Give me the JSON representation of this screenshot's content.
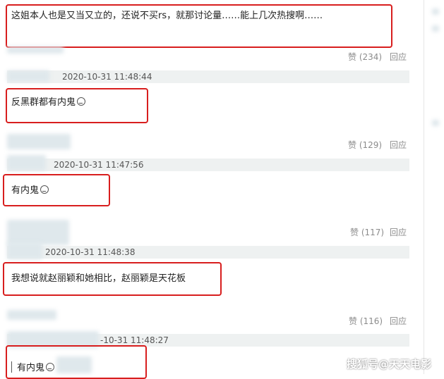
{
  "comments": [
    {
      "text": "这姐本人也是又当又立的，还说不买rs，就那讨论量……能上几次热搜啊……",
      "like": "赞 (234)",
      "reply": "回应",
      "timestamp": "2020-10-31 11:48:44"
    },
    {
      "text": "反黑群都有内鬼",
      "like": "赞 (129)",
      "reply": "回应",
      "timestamp": "2020-10-31 11:47:56"
    },
    {
      "text": "有内鬼",
      "like": "赞 (117)",
      "reply": "回应",
      "timestamp": "2020-10-31 11:48:38"
    },
    {
      "text": "我想说就赵丽颖和她相比，赵丽颖是天花板",
      "like": "赞 (116)",
      "reply": "回应",
      "timestamp": "-10-31 11:48:27"
    },
    {
      "text": "有内鬼"
    }
  ],
  "watermark": "搜狐号@天天电影",
  "colors": {
    "highlight_border": "#d81e1e",
    "meta_bar": "#eef1f1",
    "muted_text": "#8c8c8c"
  }
}
